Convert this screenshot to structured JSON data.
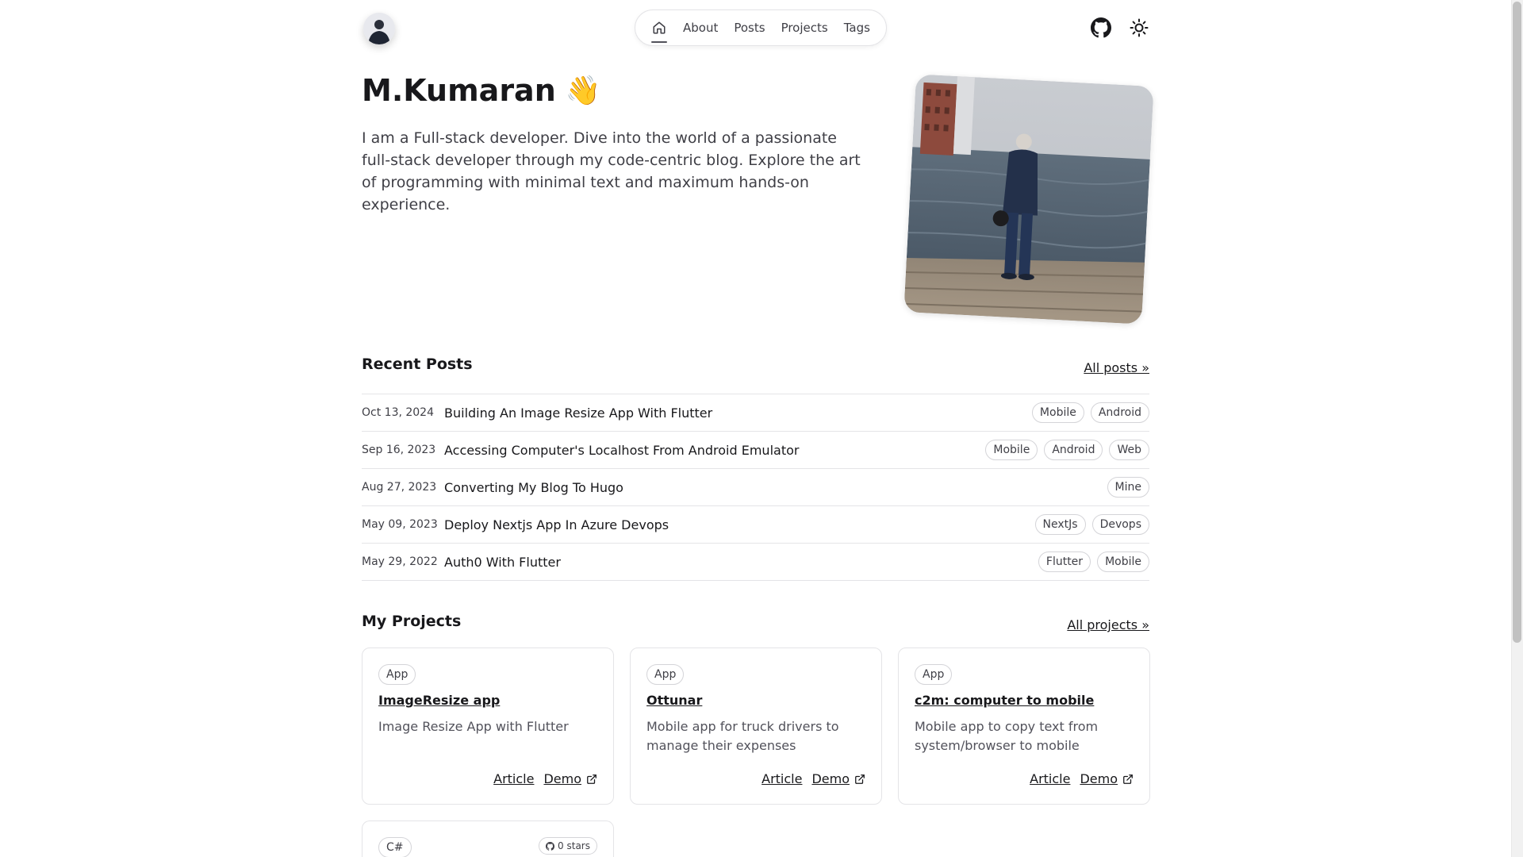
{
  "header": {
    "nav": [
      {
        "label": "About"
      },
      {
        "label": "Posts"
      },
      {
        "label": "Projects"
      },
      {
        "label": "Tags"
      }
    ]
  },
  "hero": {
    "name": "M.Kumaran",
    "wave": "👋",
    "description": "I am a Full-stack developer. Dive into the world of a passionate full-stack developer through my code-centric blog. Explore the art of programming with minimal text and maximum hands-on experience."
  },
  "recent_posts": {
    "title": "Recent Posts",
    "all_link": "All posts »",
    "items": [
      {
        "date": "Oct 13, 2024",
        "title": "Building An Image Resize App With Flutter",
        "tags": [
          "Mobile",
          "Android"
        ]
      },
      {
        "date": "Sep 16, 2023",
        "title": "Accessing Computer's Localhost From Android Emulator",
        "tags": [
          "Mobile",
          "Android",
          "Web"
        ]
      },
      {
        "date": "Aug 27, 2023",
        "title": "Converting My Blog To Hugo",
        "tags": [
          "Mine"
        ]
      },
      {
        "date": "May 09, 2023",
        "title": "Deploy Nextjs App In Azure Devops",
        "tags": [
          "NextJs",
          "Devops"
        ]
      },
      {
        "date": "May 29, 2022",
        "title": "Auth0 With Flutter",
        "tags": [
          "Flutter",
          "Mobile"
        ]
      }
    ]
  },
  "projects": {
    "title": "My Projects",
    "all_link": "All projects »",
    "items": [
      {
        "badge": "App",
        "title": "ImageResize app",
        "description": "Image Resize App with Flutter",
        "article": "Article",
        "demo": "Demo"
      },
      {
        "badge": "App",
        "title": "Ottunar",
        "description": "Mobile app for truck drivers to manage their expenses",
        "article": "Article",
        "demo": "Demo"
      },
      {
        "badge": "App",
        "title": "c2m: computer to mobile",
        "description": "Mobile app to copy text from system/browser to mobile",
        "article": "Article",
        "demo": "Demo"
      }
    ],
    "partial": {
      "badge": "C#",
      "stars": "0 stars"
    }
  },
  "colors": {
    "text": "#18181b",
    "muted": "#3f3f46",
    "border": "#e4e4e7"
  }
}
